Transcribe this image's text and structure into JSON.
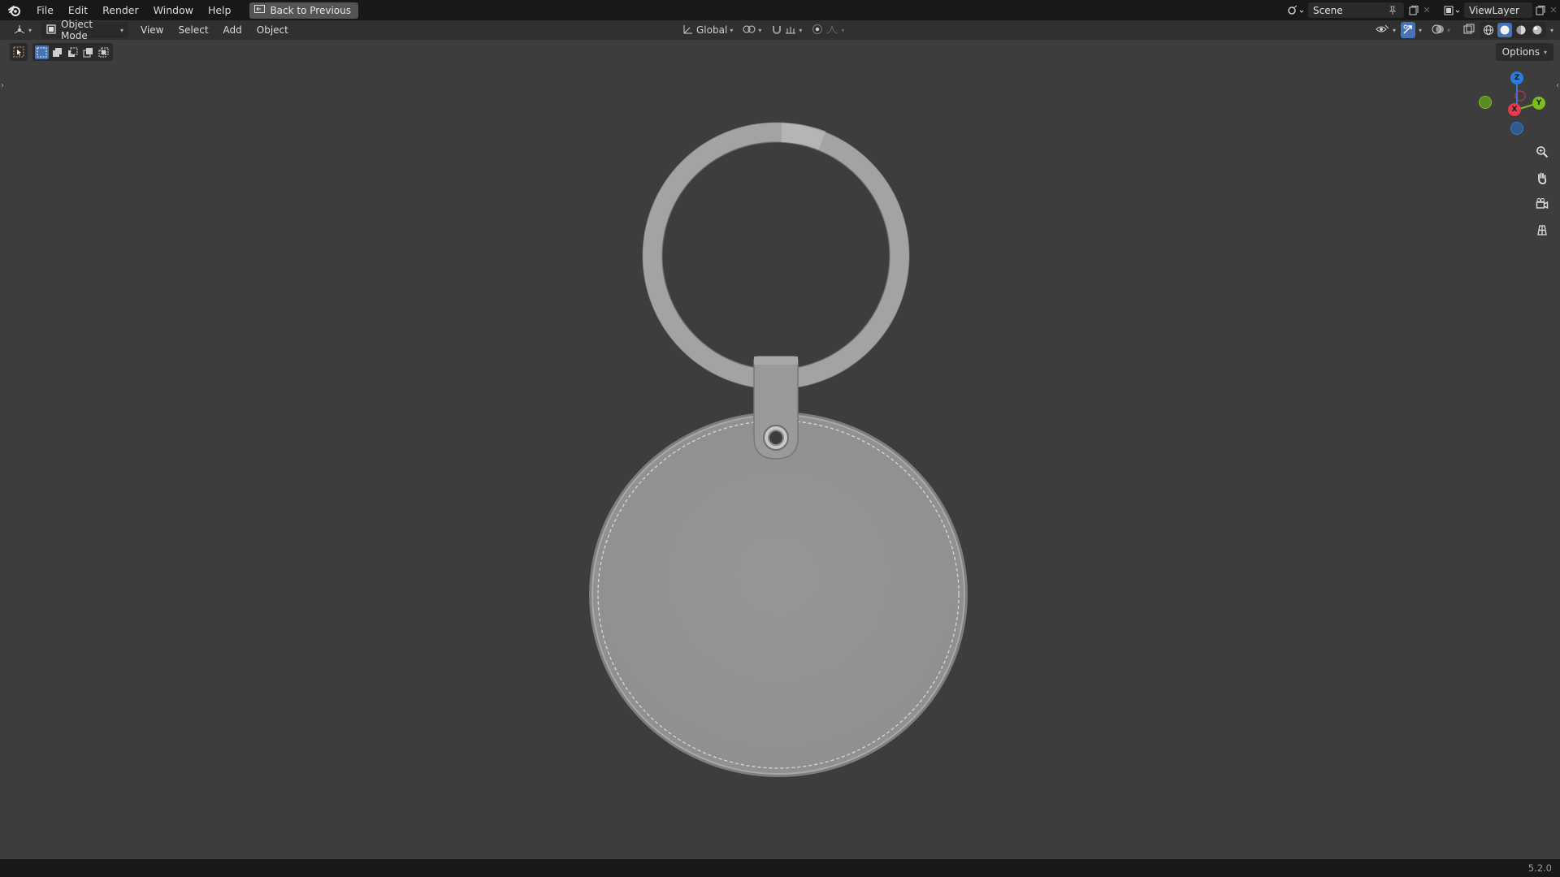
{
  "menubar": {
    "items": [
      "File",
      "Edit",
      "Render",
      "Window",
      "Help"
    ],
    "back_button": "Back to Previous",
    "scene_label": "Scene",
    "view_layer_label": "ViewLayer"
  },
  "viewport_header": {
    "mode": "Object Mode",
    "menus": [
      "View",
      "Select",
      "Add",
      "Object"
    ],
    "transform_orientation": "Global",
    "options_label": "Options"
  },
  "gizmo": {
    "axes": {
      "z": "Z",
      "y": "Y",
      "x": "X"
    },
    "colors": {
      "x": "#e23b51",
      "y": "#7cbd1d",
      "z": "#2e7bde",
      "neg_y": "#5a8a23",
      "neg_z": "#305a8a"
    }
  },
  "viewport_tools": [
    "zoom-icon",
    "pan-hand-icon",
    "camera-icon",
    "ortho-grid-icon"
  ],
  "status_bar": {
    "version": "5.2.0"
  },
  "colors": {
    "viewport_bg": "#3d3d3d",
    "topbar_bg": "#181818",
    "header_bg": "#303030",
    "accent": "#4772b3",
    "model": "#939393"
  }
}
